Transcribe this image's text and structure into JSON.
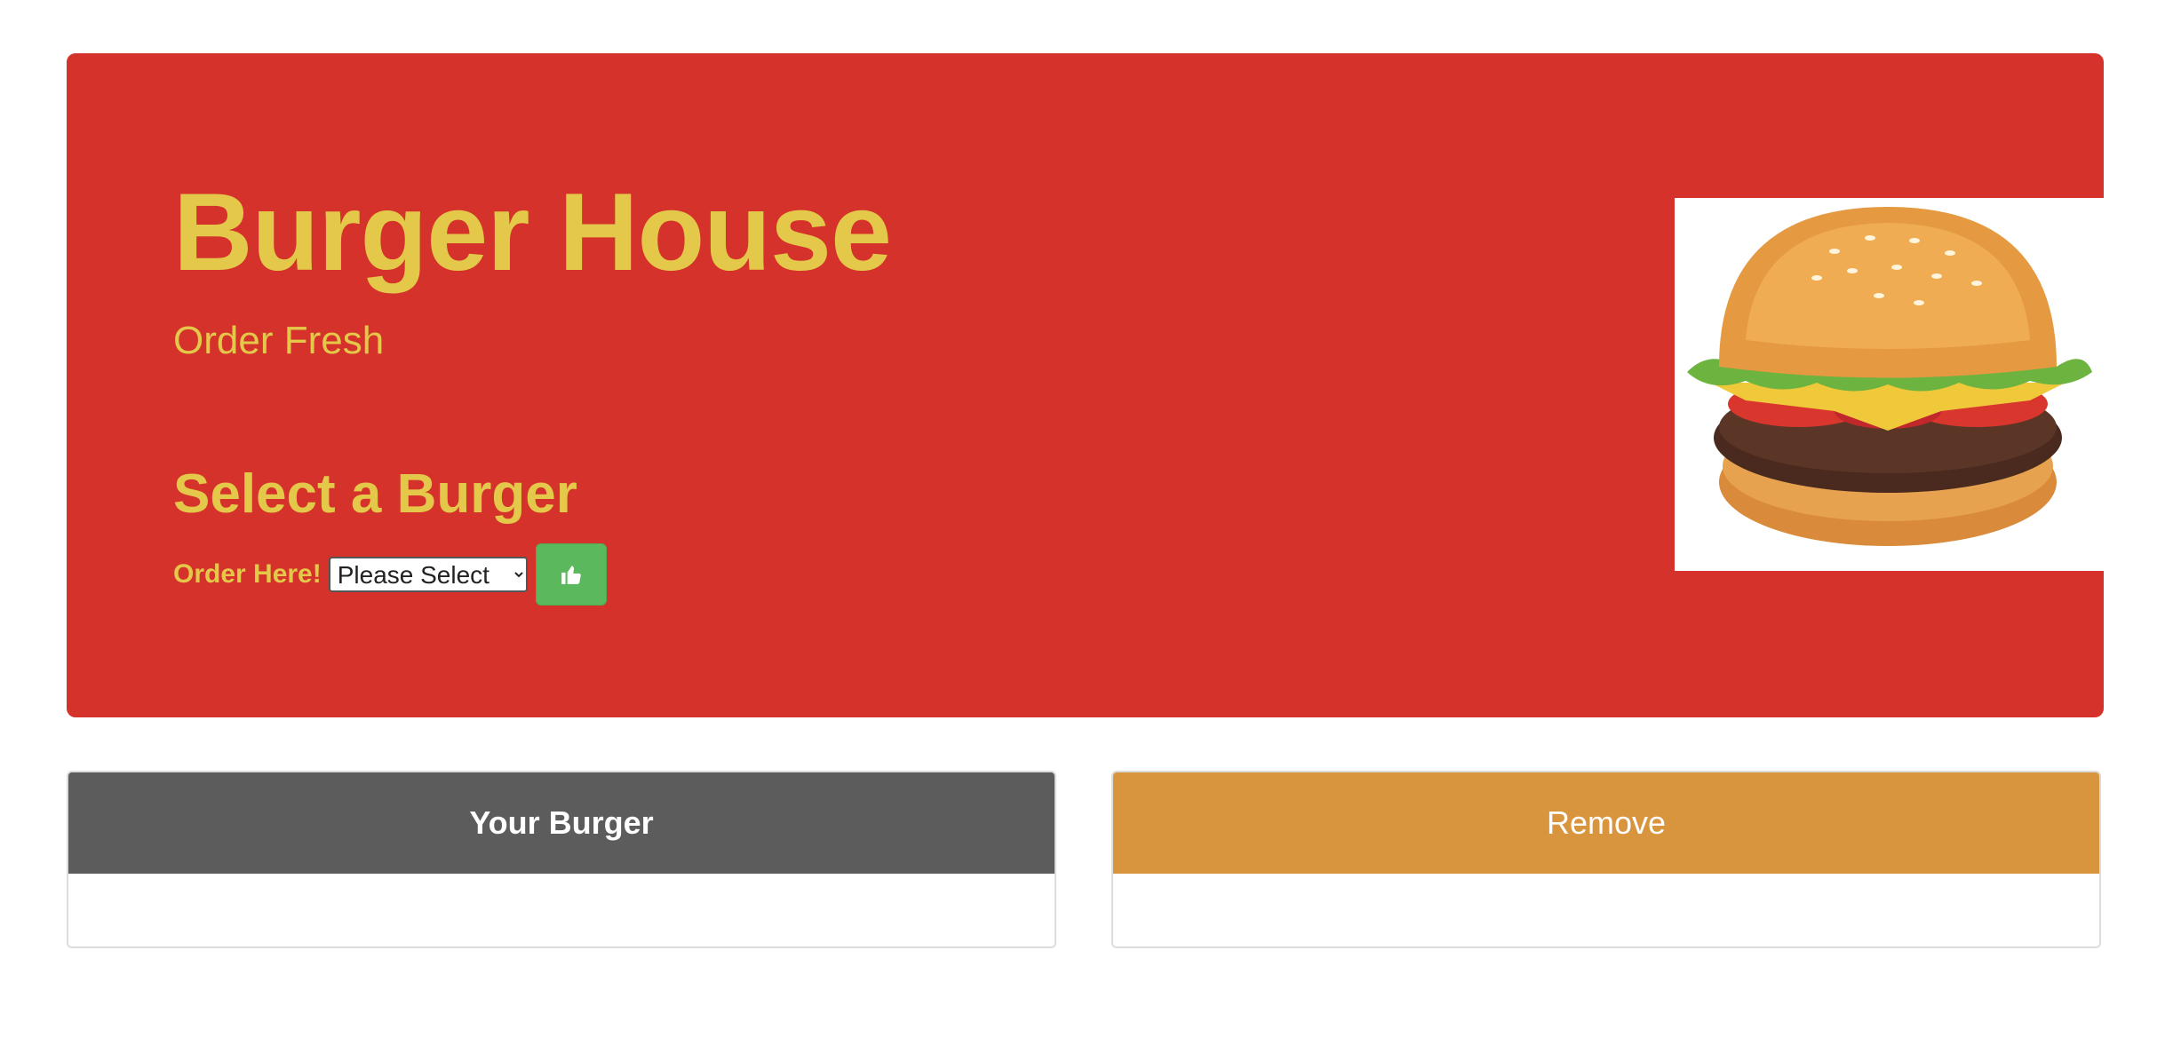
{
  "hero": {
    "title": "Burger House",
    "subtitle": "Order Fresh",
    "select_heading": "Select a Burger",
    "order_label": "Order Here!",
    "select_value": "Please Select",
    "submit_icon": "thumbs-up-icon",
    "image": "burger-illustration"
  },
  "panels": {
    "your_burger": "Your Burger",
    "remove": "Remove"
  },
  "colors": {
    "hero_bg": "#d4322a",
    "hero_text": "#e3c84a",
    "button_green": "#5cb85c",
    "panel_gray": "#5c5c5c",
    "panel_orange": "#d9953e"
  }
}
